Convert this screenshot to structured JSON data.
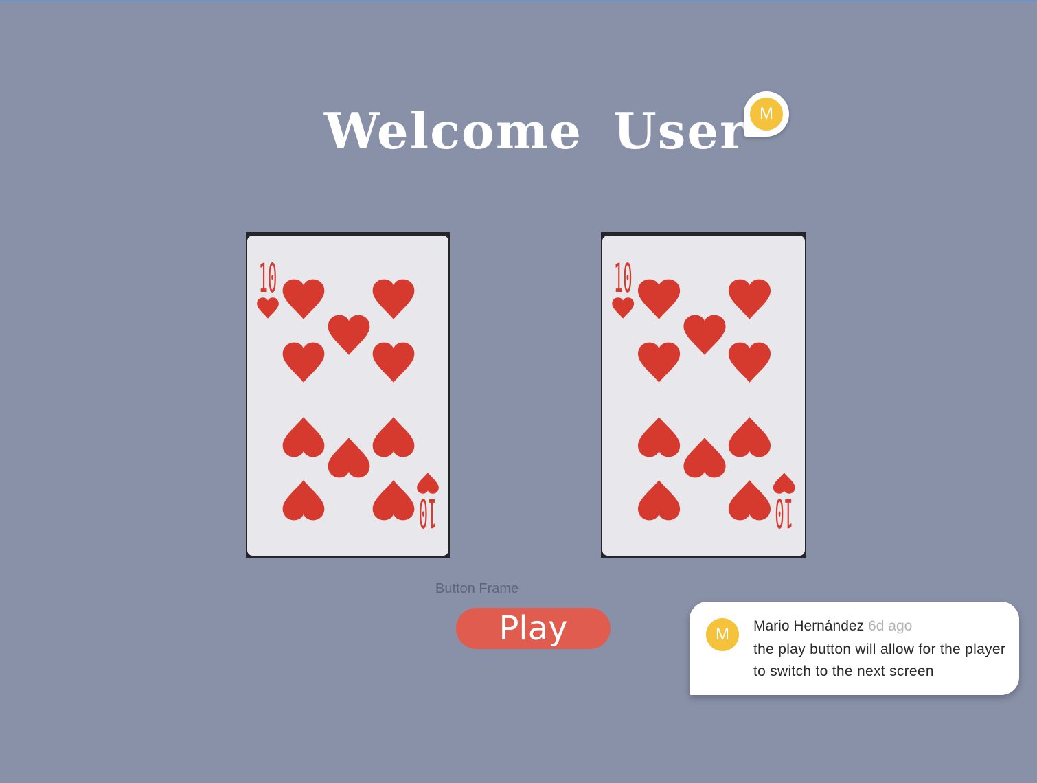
{
  "title": "Welcome  User",
  "title_avatar": {
    "initial": "M"
  },
  "cards": [
    {
      "rank": "10",
      "suit": "hearts",
      "color": "#d63a2f"
    },
    {
      "rank": "10",
      "suit": "hearts",
      "color": "#d63a2f"
    }
  ],
  "frame_label": "Button Frame",
  "play_button": {
    "label": "Play"
  },
  "comment": {
    "avatar_initial": "M",
    "author": "Mario Hernández",
    "time": "6d ago",
    "text": "the play button will allow for the player to switch to the next screen"
  },
  "colors": {
    "background": "#8991a9",
    "button": "#e05c4e",
    "avatar": "#f5c23c",
    "heart": "#d63a2f"
  }
}
